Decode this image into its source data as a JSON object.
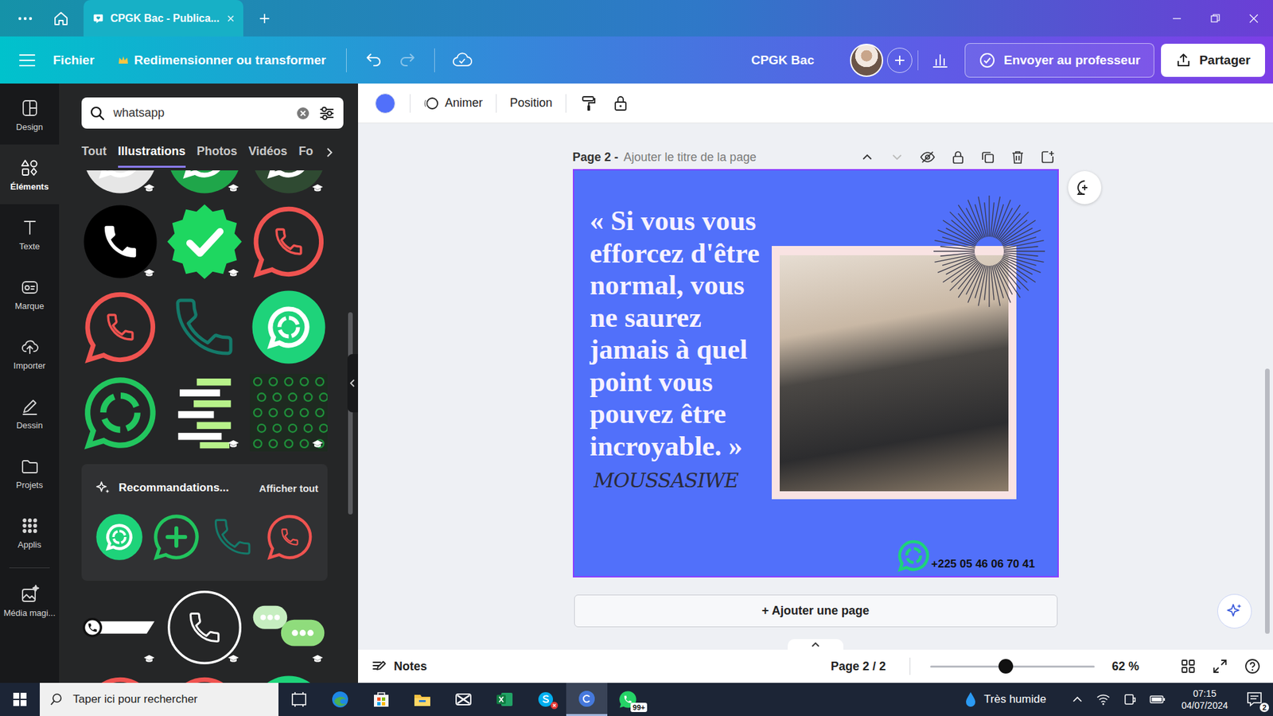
{
  "browser": {
    "tab_title": "CPGK Bac - Publica..."
  },
  "toolbar": {
    "file": "Fichier",
    "resize": "Redimensionner ou transformer",
    "project": "CPGK Bac",
    "send": "Envoyer au professeur",
    "share": "Partager"
  },
  "rail": [
    {
      "label": "Design",
      "selected": false
    },
    {
      "label": "Éléments",
      "selected": true
    },
    {
      "label": "Texte",
      "selected": false
    },
    {
      "label": "Marque",
      "selected": false
    },
    {
      "label": "Importer",
      "selected": false
    },
    {
      "label": "Dessin",
      "selected": false
    },
    {
      "label": "Projets",
      "selected": false
    },
    {
      "label": "Applis",
      "selected": false
    },
    {
      "label": "Média magi...",
      "selected": false
    }
  ],
  "panel": {
    "search": "whatsapp",
    "filters": [
      {
        "label": "Tout",
        "selected": false
      },
      {
        "label": "Illustrations",
        "selected": true
      },
      {
        "label": "Photos",
        "selected": false
      },
      {
        "label": "Vidéos",
        "selected": false
      },
      {
        "label": "Fo",
        "selected": false
      }
    ],
    "top_partial": [
      {
        "kind": "whatsapp-solid",
        "color": "#e6e6e6",
        "premium": true
      },
      {
        "kind": "whatsapp-solid",
        "color": "#1fa64a",
        "premium": true
      },
      {
        "kind": "whatsapp-solid",
        "color": "#2f4a32",
        "premium": true
      }
    ],
    "illustrations": [
      {
        "kind": "phone-solid",
        "color": "#000000",
        "premium": true
      },
      {
        "kind": "verified-badge",
        "color": "#1ed760",
        "premium": true
      },
      {
        "kind": "whatsapp-outline",
        "color": "#ef5350",
        "premium": false
      },
      {
        "kind": "whatsapp-outline",
        "color": "#ef5350",
        "premium": false
      },
      {
        "kind": "phone-outline",
        "color": "#147a6a",
        "premium": false
      },
      {
        "kind": "whatsapp-solid",
        "color": "#1ed37a",
        "premium": false
      },
      {
        "kind": "whatsapp-ring",
        "color": "#22c55e",
        "premium": false
      },
      {
        "kind": "chat-lines",
        "color": "#b8f28a",
        "premium": true
      },
      {
        "kind": "pattern",
        "color": "#1f8f3a",
        "premium": true
      }
    ],
    "recommendations": {
      "title": "Recommandations...",
      "link": "Afficher tout",
      "items": [
        {
          "kind": "whatsapp-solid",
          "color": "#1ed37a",
          "premium": false
        },
        {
          "kind": "whatsapp-plus",
          "color": "#22c55e",
          "premium": false
        },
        {
          "kind": "phone-outline",
          "color": "#147a6a",
          "premium": false
        },
        {
          "kind": "whatsapp-outline",
          "color": "#ef5350",
          "premium": false
        }
      ]
    },
    "more": [
      {
        "kind": "phone-bar",
        "color": "#ffffff",
        "premium": true
      },
      {
        "kind": "phone-circle",
        "color": "#ffffff",
        "premium": true
      },
      {
        "kind": "chat-bubbles",
        "color": "#8fdc7c",
        "premium": true
      }
    ],
    "bottom_partial": [
      {
        "kind": "whatsapp-outline",
        "color": "#ef5350",
        "premium": false
      },
      {
        "kind": "whatsapp-outline",
        "color": "#ef5350",
        "premium": false
      },
      {
        "kind": "whatsapp-solid",
        "color": "#1ed37a",
        "premium": false
      }
    ]
  },
  "context_bar": {
    "buttons": [
      "Animer",
      "Position"
    ]
  },
  "page": {
    "label": "Page 2 -",
    "title_placeholder": "Ajouter le titre de la page"
  },
  "design": {
    "quote_lines": [
      "« Si vous vous",
      "efforcez d'être",
      "normal, vous",
      "ne saurez",
      "jamais à quel",
      "point vous",
      "pouvez être",
      "incroyable. »"
    ],
    "signature": "MOUSSASIWE",
    "phone": "+225 05 46 06 70 41"
  },
  "add_page": "+ Ajouter une page",
  "footer": {
    "notes": "Notes",
    "page": "Page 2 / 2",
    "zoom_level": 0.46,
    "zoom": "62 %"
  },
  "taskbar": {
    "search_placeholder": "Taper ici pour rechercher",
    "apps": [
      {
        "kind": "taskview",
        "selected": false,
        "alert": false,
        "badge": ""
      },
      {
        "kind": "edge",
        "selected": false,
        "alert": false,
        "badge": ""
      },
      {
        "kind": "store",
        "selected": false,
        "alert": false,
        "badge": ""
      },
      {
        "kind": "explorer",
        "selected": false,
        "alert": false,
        "badge": ""
      },
      {
        "kind": "capcut",
        "selected": false,
        "alert": false,
        "badge": ""
      },
      {
        "kind": "excel",
        "selected": false,
        "alert": false,
        "badge": ""
      },
      {
        "kind": "skype",
        "selected": false,
        "alert": true,
        "badge": ""
      },
      {
        "kind": "canva",
        "selected": true,
        "alert": false,
        "badge": ""
      },
      {
        "kind": "whatsapp",
        "selected": false,
        "alert": false,
        "badge": "99+"
      }
    ],
    "weather": "Très humide",
    "time": "07:15",
    "date": "04/07/2024",
    "notifications": "2"
  }
}
